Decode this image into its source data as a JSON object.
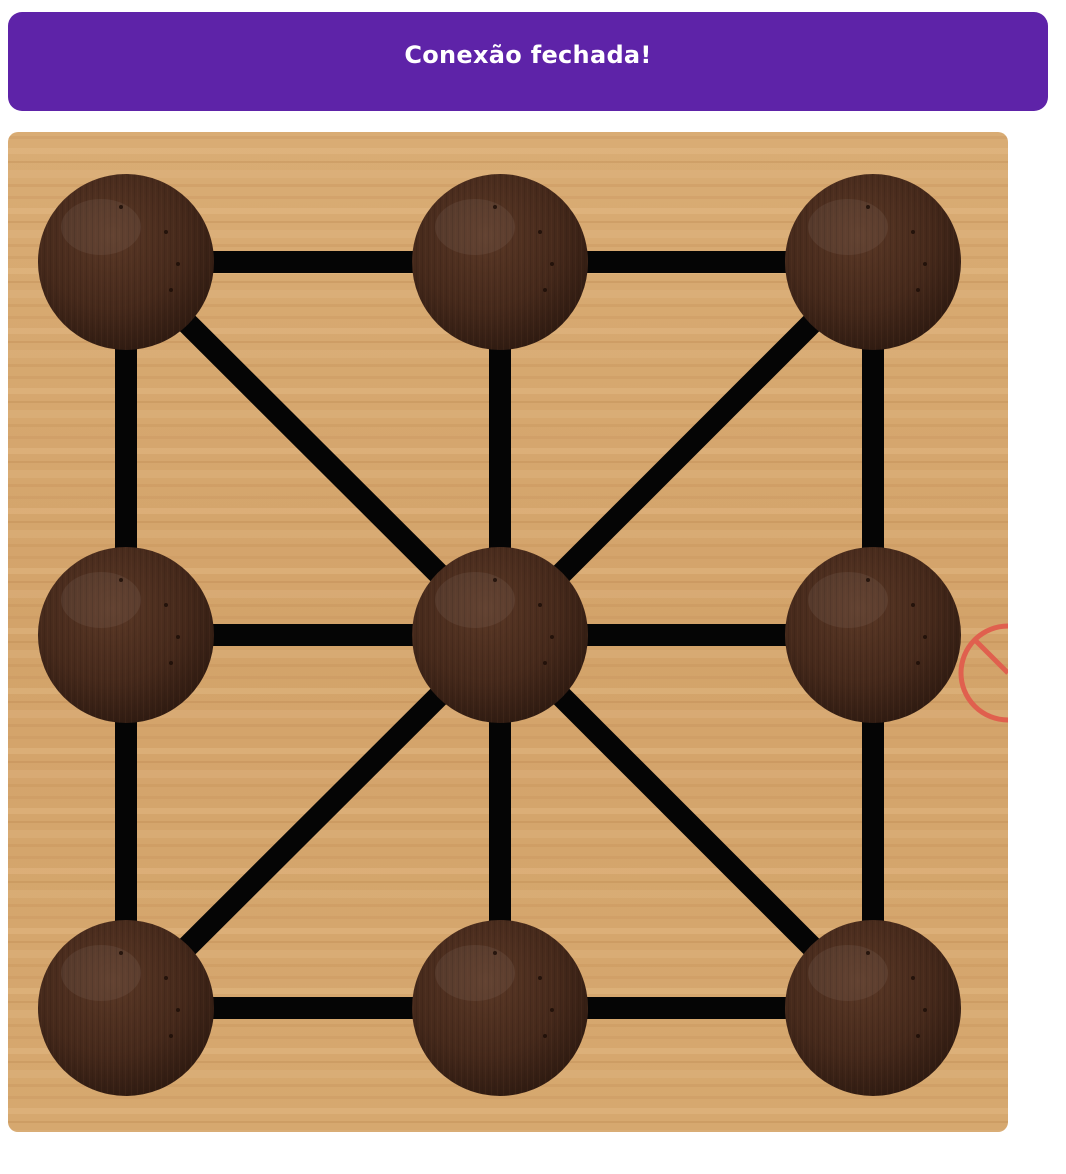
{
  "status": {
    "message": "Conexão fechada!"
  },
  "colors": {
    "banner": "#5e23a8",
    "board_wood": "#d8ab73",
    "line": "#050505",
    "piece": "#4a2d1f",
    "blocked_icon": "#e0604e"
  },
  "board": {
    "nodes": [
      {
        "id": "top-left",
        "row": 0,
        "col": 0,
        "occupied": true
      },
      {
        "id": "top-center",
        "row": 0,
        "col": 1,
        "occupied": true
      },
      {
        "id": "top-right",
        "row": 0,
        "col": 2,
        "occupied": true
      },
      {
        "id": "middle-left",
        "row": 1,
        "col": 0,
        "occupied": true
      },
      {
        "id": "center",
        "row": 1,
        "col": 1,
        "occupied": true
      },
      {
        "id": "middle-right",
        "row": 1,
        "col": 2,
        "occupied": true
      },
      {
        "id": "bottom-left",
        "row": 2,
        "col": 0,
        "occupied": true
      },
      {
        "id": "bottom-center",
        "row": 2,
        "col": 1,
        "occupied": true
      },
      {
        "id": "bottom-right",
        "row": 2,
        "col": 2,
        "occupied": true
      }
    ],
    "connections": [
      [
        "top-left",
        "top-center"
      ],
      [
        "top-center",
        "top-right"
      ],
      [
        "middle-left",
        "center"
      ],
      [
        "center",
        "middle-right"
      ],
      [
        "bottom-left",
        "bottom-center"
      ],
      [
        "bottom-center",
        "bottom-right"
      ],
      [
        "top-left",
        "middle-left"
      ],
      [
        "middle-left",
        "bottom-left"
      ],
      [
        "top-center",
        "center"
      ],
      [
        "center",
        "bottom-center"
      ],
      [
        "top-right",
        "middle-right"
      ],
      [
        "middle-right",
        "bottom-right"
      ],
      [
        "top-left",
        "center"
      ],
      [
        "center",
        "bottom-right"
      ],
      [
        "top-right",
        "center"
      ],
      [
        "center",
        "bottom-left"
      ]
    ]
  },
  "icons": {
    "blocked": "no-entry-icon"
  }
}
